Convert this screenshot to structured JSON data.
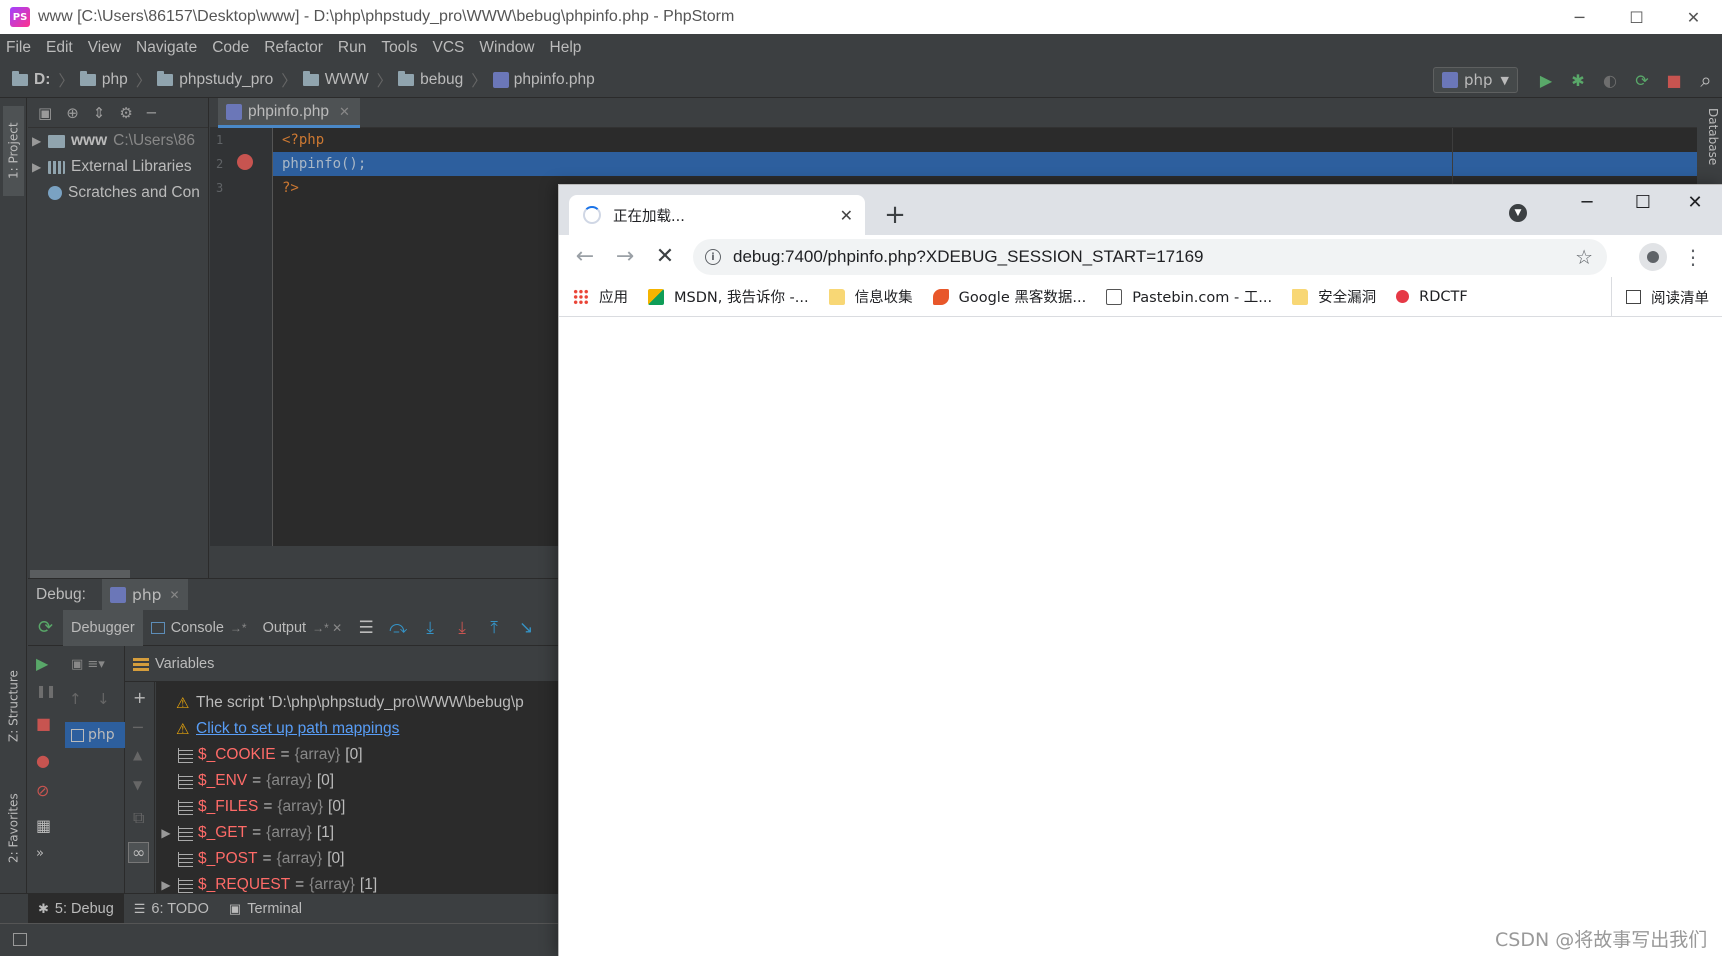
{
  "ide": {
    "window_title": "www [C:\\Users\\86157\\Desktop\\www] - D:\\php\\phpstudy_pro\\WWW\\bebug\\phpinfo.php - PhpStorm",
    "app_icon_text": "PS",
    "window_controls": {
      "minimize": "─",
      "maximize": "☐",
      "close": "✕"
    },
    "menu": [
      "File",
      "Edit",
      "View",
      "Navigate",
      "Code",
      "Refactor",
      "Run",
      "Tools",
      "VCS",
      "Window",
      "Help"
    ],
    "breadcrumbs": [
      "D:",
      "php",
      "phpstudy_pro",
      "WWW",
      "bebug",
      "phpinfo.php"
    ],
    "breadcrumb_sep": "〉",
    "run_config": "php",
    "toolbar_icons": {
      "run": "▶",
      "debug": "✱",
      "coverage": "◐",
      "profile": "⟳",
      "stop": "■",
      "search": "⌕"
    },
    "left_stripe": {
      "project": "1: Project",
      "structure": "Z: Structure",
      "favorites": "2: Favorites"
    },
    "right_stripe": {
      "database": "Database"
    },
    "project_toolbar_icons": [
      "▣",
      "⊕",
      "⇕",
      "⚙",
      "─"
    ],
    "project_tree": [
      {
        "name": "www",
        "path": "C:\\Users\\86",
        "bold": true
      },
      {
        "name": "External Libraries",
        "path": ""
      },
      {
        "name": "Scratches and Con",
        "path": ""
      }
    ],
    "tree_arrow": "▶",
    "editor_tab": {
      "name": "phpinfo.php",
      "close": "✕"
    },
    "code_lines": [
      {
        "no": "1",
        "text": "<?php"
      },
      {
        "no": "2",
        "text": "phpinfo();"
      },
      {
        "no": "3",
        "text": "?>"
      }
    ],
    "debug": {
      "label": "Debug:",
      "session_tab": "php",
      "session_close": "✕",
      "subtabs": [
        {
          "label": "Debugger",
          "suffix": ""
        },
        {
          "label": "Console",
          "suffix": "→*"
        },
        {
          "label": "Output",
          "suffix": "→* ✕"
        }
      ],
      "step_icons": [
        "☰",
        "⤼",
        "⤓",
        "⤓",
        "⤒",
        "↘"
      ],
      "left_icons": {
        "rerun": "⟳",
        "resume": "▶",
        "pause": "❚❚",
        "stop": "■",
        "breakpoints": "●",
        "mute": "⊘",
        "layout": "▦",
        "more": "»"
      },
      "frames_toolbar": "▣ ≡▾",
      "frame_item": "php",
      "var_toolbar_icons": [
        "+",
        "─",
        "▲",
        "▼",
        "⧉",
        "∞"
      ],
      "variables_label": "Variables",
      "messages": [
        {
          "icon": "⚠",
          "text": "The script 'D:\\php\\phpstudy_pro\\WWW\\bebug\\p",
          "link": false
        },
        {
          "icon": "⚠",
          "text": "Click to set up path mappings",
          "link": true
        }
      ],
      "variables": [
        {
          "name": "$_COOKIE",
          "type": "{array}",
          "count": "[0]",
          "expandable": false
        },
        {
          "name": "$_ENV",
          "type": "{array}",
          "count": "[0]",
          "expandable": false
        },
        {
          "name": "$_FILES",
          "type": "{array}",
          "count": "[0]",
          "expandable": false
        },
        {
          "name": "$_GET",
          "type": "{array}",
          "count": "[1]",
          "expandable": true
        },
        {
          "name": "$_POST",
          "type": "{array}",
          "count": "[0]",
          "expandable": false
        },
        {
          "name": "$_REQUEST",
          "type": "{array}",
          "count": "[1]",
          "expandable": true
        }
      ],
      "eq": "="
    },
    "bottom_tabs": [
      {
        "icon": "✱",
        "label": "5: Debug"
      },
      {
        "icon": "☰",
        "label": "6: TODO"
      },
      {
        "icon": "▣",
        "label": "Terminal"
      }
    ]
  },
  "browser": {
    "tab_title": "正在加载...",
    "tab_close": "✕",
    "new_tab": "+",
    "tab_search_icon": "▼",
    "window_controls": {
      "minimize": "─",
      "maximize": "☐",
      "close": "✕"
    },
    "nav": {
      "back": "←",
      "forward": "→",
      "stop": "✕"
    },
    "info_icon": "i",
    "url": "debug:7400/phpinfo.php?XDEBUG_SESSION_START=17169",
    "star_icon": "☆",
    "menu_icon": "⋮",
    "bookmarks": [
      {
        "icon": "grid",
        "label": "应用"
      },
      {
        "icon": "msdn",
        "label": "MSDN, 我告诉你 -..."
      },
      {
        "icon": "folder",
        "label": "信息收集"
      },
      {
        "icon": "google",
        "label": "Google 黑客数据..."
      },
      {
        "icon": "paste",
        "label": "Pastebin.com - 工..."
      },
      {
        "icon": "folder",
        "label": "安全漏洞"
      },
      {
        "icon": "rdctf",
        "label": "RDCTF"
      }
    ],
    "reading_list": "阅读清单"
  },
  "watermark": "CSDN @将故事写出我们",
  "colors": {
    "ide_bg": "#3c3f41",
    "editor_bg": "#2b2b2b",
    "selection": "#2d5f9e",
    "keyword": "#cc7832",
    "var_name": "#ff6b68",
    "link": "#589df6",
    "browser_tabstrip": "#dee1e6",
    "browser_accent": "#1a73e8"
  }
}
